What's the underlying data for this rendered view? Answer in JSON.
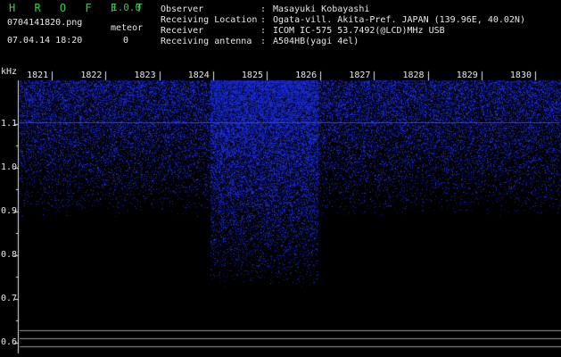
{
  "header": {
    "brand": "H R O F F T",
    "version": "1.0.0",
    "filename": "0704141820.png",
    "meteor_label": "meteor",
    "datetime": "07.04.14 18:20",
    "meteor_count": "0"
  },
  "info": [
    {
      "key": "Observer",
      "value": "Masayuki Kobayashi"
    },
    {
      "key": "Receiving Location",
      "value": "Ogata-vill. Akita-Pref. JAPAN (139.96E, 40.02N)"
    },
    {
      "key": "Receiver",
      "value": "ICOM IC-575 53.7492(@LCD)MHz USB"
    },
    {
      "key": "Receiving antenna",
      "value": "A504HB(yagi 4el)"
    }
  ],
  "colors": {
    "background": "#000000",
    "signal": "#2a3cff",
    "text": "#e8e8e8",
    "brand": "#33d04a"
  },
  "spectrogram": {
    "y_unit": "kHz",
    "y_ticks": [
      "1.1",
      "1.0",
      "0.9",
      "0.8",
      "0.7",
      "0.6"
    ],
    "x_ticks": [
      "1821",
      "1822",
      "1823",
      "1824",
      "1825",
      "1826",
      "1827",
      "1828",
      "1829",
      "1830"
    ],
    "y_range": [
      0.575,
      1.2
    ],
    "x_range": [
      1820.4,
      1830.45
    ],
    "bright_columns": [
      1824,
      1825
    ],
    "carrier_khz": 1.105
  }
}
